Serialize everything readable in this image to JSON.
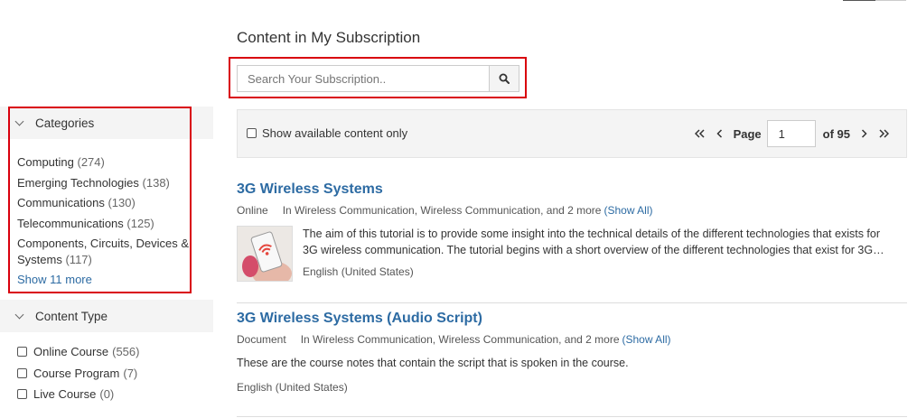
{
  "page": {
    "title": "Content in My Subscription"
  },
  "search": {
    "placeholder": "Search Your Subscription.."
  },
  "filters": {
    "categories": {
      "header": "Categories",
      "items": [
        {
          "label": "Computing",
          "count": "(274)"
        },
        {
          "label": "Emerging Technologies",
          "count": "(138)"
        },
        {
          "label": "Communications",
          "count": "(130)"
        },
        {
          "label": "Telecommunications",
          "count": "(125)"
        },
        {
          "label": "Components, Circuits, Devices & Systems",
          "count": "(117)"
        }
      ],
      "show_more": "Show 11 more"
    },
    "content_type": {
      "header": "Content Type",
      "items": [
        {
          "label": "Online Course",
          "count": "(556)"
        },
        {
          "label": "Course Program",
          "count": "(7)"
        },
        {
          "label": "Live Course",
          "count": "(0)"
        }
      ]
    }
  },
  "toolbar": {
    "available_label": "Show available content only",
    "page_label": "Page",
    "page_value": "1",
    "of_label": "of 95"
  },
  "results": [
    {
      "title": "3G Wireless Systems",
      "type": "Online",
      "categories": "In Wireless Communication, Wireless Communication, and 2 more",
      "show_all": "(Show All)",
      "desc_line1": "The aim of this tutorial is to provide some insight into the technical  details of the different technologies that exists for",
      "desc_line2": "3G wireless  communication. The tutorial begins with a short overview of the  different technologies that exist for 3G…",
      "language": "English (United States)"
    },
    {
      "title": "3G Wireless Systems (Audio Script)",
      "type": "Document",
      "categories": "In Wireless Communication, Wireless Communication, and 2 more",
      "show_all": "(Show All)",
      "desc": "These are the course notes that contain the script that is spoken in the course.",
      "language": "English (United States)"
    }
  ],
  "colors": {
    "link": "#2d6ba3",
    "highlight": "#d9000d",
    "panel": "#f4f4f4"
  }
}
